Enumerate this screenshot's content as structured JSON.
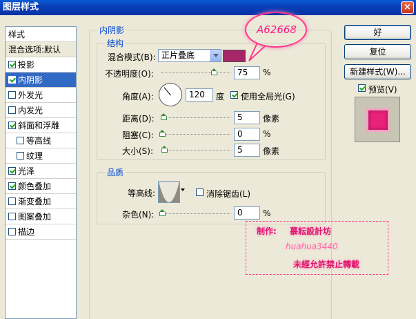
{
  "window": {
    "title": "图层样式",
    "close": "×"
  },
  "stylelist": {
    "items": [
      {
        "label": "样式",
        "type": "header"
      },
      {
        "label": "混合选项:默认",
        "type": "plain"
      },
      {
        "label": "投影",
        "checked": true
      },
      {
        "label": "内阴影",
        "checked": true,
        "selected": true
      },
      {
        "label": "外发光",
        "checked": false
      },
      {
        "label": "内发光",
        "checked": false
      },
      {
        "label": "斜面和浮雕",
        "checked": true
      },
      {
        "label": "等高线",
        "checked": false,
        "indent": true
      },
      {
        "label": "纹理",
        "checked": false,
        "indent": true
      },
      {
        "label": "光泽",
        "checked": true
      },
      {
        "label": "颜色叠加",
        "checked": true
      },
      {
        "label": "渐变叠加",
        "checked": false
      },
      {
        "label": "图案叠加",
        "checked": false
      },
      {
        "label": "描边",
        "checked": false
      }
    ]
  },
  "inner_shadow": {
    "title": "内阴影",
    "structure": {
      "title": "结构",
      "blend_mode_label": "混合模式(B):",
      "blend_mode_value": "正片叠底",
      "color": "#a62668",
      "opacity_label": "不透明度(O):",
      "opacity_value": "75",
      "opacity_level": 0.75,
      "opacity_unit": "%",
      "angle_label": "角度(A):",
      "angle_value": "120",
      "angle_unit": "度",
      "global_light_label": "使用全局光(G)",
      "global_light_checked": true,
      "distance_label": "距离(D):",
      "distance_value": "5",
      "distance_unit": "像素",
      "choke_label": "阻塞(C):",
      "choke_value": "0",
      "choke_unit": "%",
      "size_label": "大小(S):",
      "size_value": "5",
      "size_unit": "像素"
    },
    "quality": {
      "title": "品质",
      "contour_label": "等高线:",
      "antialias_label": "消除锯齿(L)",
      "antialias_checked": false,
      "noise_label": "杂色(N):",
      "noise_value": "0",
      "noise_unit": "%"
    }
  },
  "buttons": {
    "ok": "好",
    "reset": "复位",
    "new_style": "新建样式(W)...",
    "preview_label": "预览(V)",
    "preview_checked": true
  },
  "annotations": {
    "color_code": "A62668",
    "author_label": "制作:",
    "author_name": "慕耘設計坊",
    "handle": "huahua3440",
    "notice": "未經允許禁止轉載"
  }
}
